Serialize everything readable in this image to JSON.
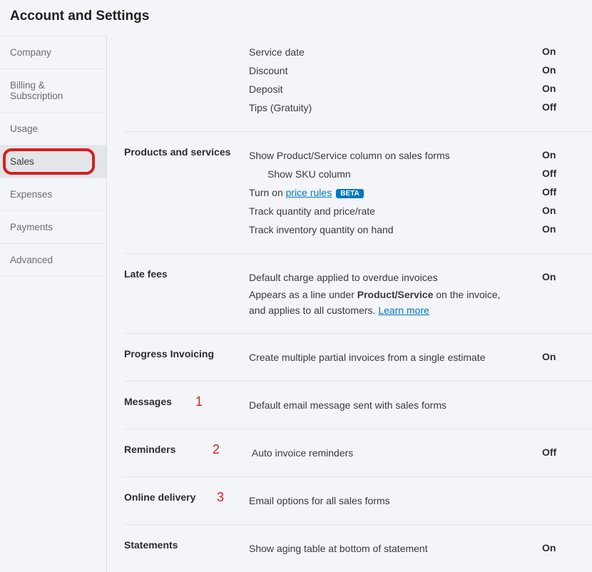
{
  "page_title": "Account and Settings",
  "nav": [
    {
      "label": "Company",
      "active": false
    },
    {
      "label": "Billing & Subscription",
      "active": false
    },
    {
      "label": "Usage",
      "active": false
    },
    {
      "label": "Sales",
      "active": true,
      "highlight": true
    },
    {
      "label": "Expenses",
      "active": false
    },
    {
      "label": "Payments",
      "active": false
    },
    {
      "label": "Advanced",
      "active": false
    }
  ],
  "top_rows": [
    {
      "label": "Service date",
      "value": "On"
    },
    {
      "label": "Discount",
      "value": "On"
    },
    {
      "label": "Deposit",
      "value": "On"
    },
    {
      "label": "Tips (Gratuity)",
      "value": "Off"
    }
  ],
  "products": {
    "heading": "Products and services",
    "rows": [
      {
        "label": "Show Product/Service column on sales forms",
        "value": "On"
      },
      {
        "label": "Show SKU column",
        "value": "Off",
        "indent": true
      },
      {
        "label": "",
        "value": "Off",
        "price_rules": true
      },
      {
        "label": "Track quantity and price/rate",
        "value": "On"
      },
      {
        "label": "Track inventory quantity on hand",
        "value": "On"
      }
    ],
    "price_rules_prefix": "Turn on ",
    "price_rules_link": "price rules",
    "beta": "BETA"
  },
  "late_fees": {
    "heading": "Late fees",
    "line1": "Default charge applied to overdue invoices",
    "value": "On",
    "line2a": "Appears as a line under ",
    "line2b": "Product/Service",
    "line2c": " on the invoice, and applies to all customers. ",
    "learn": "Learn more"
  },
  "progress": {
    "heading": "Progress Invoicing",
    "label": "Create multiple partial invoices from a single estimate",
    "value": "On"
  },
  "messages": {
    "heading": "Messages",
    "label": "Default email message sent with sales forms",
    "anno": "1"
  },
  "reminders": {
    "heading": "Reminders",
    "label": "Auto invoice reminders",
    "value": "Off",
    "anno": "2"
  },
  "online": {
    "heading": "Online delivery",
    "label": "Email options for all sales forms",
    "anno": "3"
  },
  "statements": {
    "heading": "Statements",
    "label": "Show aging table at bottom of statement",
    "value": "On"
  }
}
